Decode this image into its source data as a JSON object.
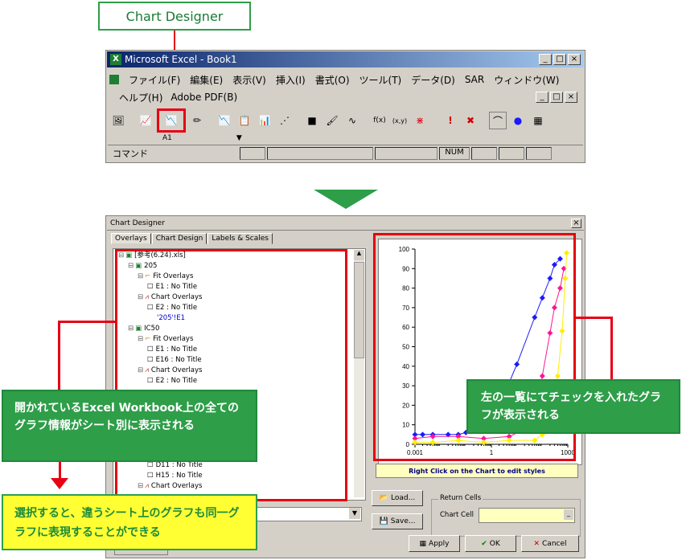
{
  "callout_top": {
    "label": "Chart Designer"
  },
  "excel": {
    "title": "Microsoft Excel - Book1",
    "menu_row1": [
      "ファイル(F)",
      "編集(E)",
      "表示(V)",
      "挿入(I)",
      "書式(O)",
      "ツール(T)",
      "データ(D)",
      "SAR",
      "ウィンドウ(W)"
    ],
    "menu_row2": [
      "ヘルプ(H)",
      "Adobe PDF(B)"
    ],
    "namebox": "A1",
    "status_left": "コマンド",
    "status_num": "NUM",
    "sys_min": "_",
    "sys_max": "□",
    "sys_close": "×"
  },
  "dialog": {
    "title": "Chart Designer",
    "close": "×",
    "tabs": [
      "Overlays",
      "Chart Design",
      "Labels & Scales"
    ],
    "tree": [
      {
        "indent": 0,
        "text": "[参考(6.24).xls]",
        "icon": "book"
      },
      {
        "indent": 1,
        "text": "205",
        "icon": "sheet"
      },
      {
        "indent": 2,
        "text": "Fit Overlays",
        "icon": "fit"
      },
      {
        "indent": 3,
        "text": "E1 : No Title",
        "icon": "check"
      },
      {
        "indent": 2,
        "text": "Chart Overlays",
        "icon": "chart"
      },
      {
        "indent": 3,
        "text": "E2 : No Title",
        "icon": "check"
      },
      {
        "indent": 4,
        "text": "'205'!E1",
        "icon": "link"
      },
      {
        "indent": 1,
        "text": "IC50",
        "icon": "sheet"
      },
      {
        "indent": 2,
        "text": "Fit Overlays",
        "icon": "fit"
      },
      {
        "indent": 3,
        "text": "E1 : No Title",
        "icon": "check"
      },
      {
        "indent": 3,
        "text": "E16 : No Title",
        "icon": "check"
      },
      {
        "indent": 2,
        "text": "Chart Overlays",
        "icon": "chart"
      },
      {
        "indent": 3,
        "text": "E2 : No Title",
        "icon": "check"
      }
    ],
    "tree_lower": [
      {
        "indent": 3,
        "text": "D11 : No Title",
        "icon": "check"
      },
      {
        "indent": 3,
        "text": "H15 : No Title",
        "icon": "check"
      },
      {
        "indent": 2,
        "text": "Chart Overlays",
        "icon": "chart"
      }
    ],
    "chart_hint": "Right Click on the Chart to edit styles",
    "load_btn": "Load...",
    "save_btn": "Save...",
    "return_cells_label": "Return Cells",
    "chart_cell_label": "Chart Cell",
    "apply_btn": "Apply",
    "ok_btn": "OK",
    "cancel_btn": "Cancel"
  },
  "notes": {
    "left": "開かれているExcel Workbook上の全てのグラフ情報がシート別に表示される",
    "right": "左の一覧にてチェックを入れたグラフが表示される",
    "bottom": "選択すると、違うシート上のグラフも同一グラフに表現することができる"
  },
  "colors": {
    "green": "#2e9e49",
    "red": "#e60012",
    "blue_series": "#1a1aff",
    "magenta_series": "#ff1493",
    "yellow_series": "#ffee00"
  },
  "chart_data": {
    "type": "scatter",
    "x_scale": "log",
    "xlim": [
      0.001,
      1000
    ],
    "ylim": [
      0,
      100
    ],
    "x_ticks": [
      "0.001",
      "1",
      "1000"
    ],
    "y_ticks": [
      0,
      10,
      20,
      30,
      40,
      50,
      60,
      70,
      80,
      90,
      100
    ],
    "series": [
      {
        "color": "#1a1aff",
        "x": [
          0.001,
          0.002,
          0.005,
          0.02,
          0.05,
          0.1,
          1,
          10,
          50,
          100,
          200,
          300,
          500
        ],
        "y": [
          5,
          5,
          5,
          5,
          5,
          6,
          10,
          41,
          65,
          75,
          85,
          92,
          95
        ]
      },
      {
        "color": "#ff1493",
        "x": [
          0.001,
          0.005,
          0.05,
          0.5,
          5,
          50,
          100,
          200,
          300,
          500,
          700
        ],
        "y": [
          3,
          4,
          4,
          3,
          4,
          10,
          35,
          57,
          70,
          80,
          90
        ]
      },
      {
        "color": "#ffee00",
        "x": [
          0.001,
          0.005,
          0.05,
          0.5,
          5,
          50,
          100,
          200,
          400,
          600,
          800,
          900
        ],
        "y": [
          1,
          1,
          2,
          1,
          2,
          2,
          5,
          15,
          35,
          58,
          85,
          98
        ]
      }
    ]
  }
}
